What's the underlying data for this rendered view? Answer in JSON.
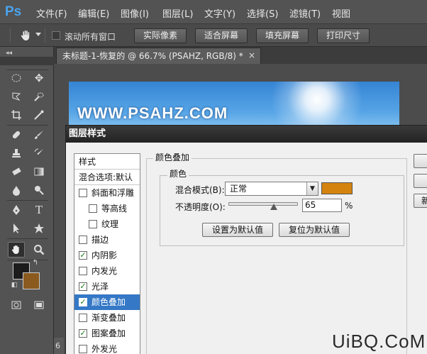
{
  "app": {
    "logo": "Ps"
  },
  "menu": [
    "文件(F)",
    "编辑(E)",
    "图像(I)",
    "图层(L)",
    "文字(Y)",
    "选择(S)",
    "滤镜(T)",
    "视图"
  ],
  "options_bar": {
    "scroll_all_label": "滚动所有窗口",
    "buttons": [
      "实际像素",
      "适合屏幕",
      "填充屏幕",
      "打印尺寸"
    ]
  },
  "document_tab": {
    "title": "未标题-1-恢复的 @ 66.7% (PSAHZ, RGB/8) *",
    "close": "×"
  },
  "toolbox": {
    "collapse": "◂◂"
  },
  "canvas": {
    "text": "WWW.PSAHZ.COM",
    "zoom_hint": "6"
  },
  "colors": {
    "foreground": "#1c1c1c",
    "background": "#8a5a1e",
    "overlay_color": "#d4840e",
    "accent": "#3478c6"
  },
  "dialog": {
    "title": "图层样式",
    "style_list": {
      "header": "样式",
      "blend_options": "混合选项:默认",
      "items": [
        {
          "label": "斜面和浮雕",
          "checked": false,
          "indent": false,
          "selected": false
        },
        {
          "label": "等高线",
          "checked": false,
          "indent": true,
          "selected": false
        },
        {
          "label": "纹理",
          "checked": false,
          "indent": true,
          "selected": false
        },
        {
          "label": "描边",
          "checked": false,
          "indent": false,
          "selected": false
        },
        {
          "label": "内阴影",
          "checked": true,
          "indent": false,
          "selected": false
        },
        {
          "label": "内发光",
          "checked": false,
          "indent": false,
          "selected": false
        },
        {
          "label": "光泽",
          "checked": true,
          "indent": false,
          "selected": false
        },
        {
          "label": "颜色叠加",
          "checked": true,
          "indent": false,
          "selected": true
        },
        {
          "label": "渐变叠加",
          "checked": false,
          "indent": false,
          "selected": false
        },
        {
          "label": "图案叠加",
          "checked": true,
          "indent": false,
          "selected": false
        },
        {
          "label": "外发光",
          "checked": false,
          "indent": false,
          "selected": false
        }
      ]
    },
    "panel": {
      "section_title": "颜色叠加",
      "group_title": "颜色",
      "blend_mode_label": "混合模式(B):",
      "blend_mode_value": "正常",
      "opacity_label": "不透明度(O):",
      "opacity_value": "65",
      "opacity_fraction": 0.65,
      "opacity_unit": "%",
      "make_default": "设置为默认值",
      "reset_default": "复位为默认值"
    },
    "right_buttons": [
      "",
      "",
      "新"
    ]
  },
  "watermark": "UiBQ.CoM"
}
